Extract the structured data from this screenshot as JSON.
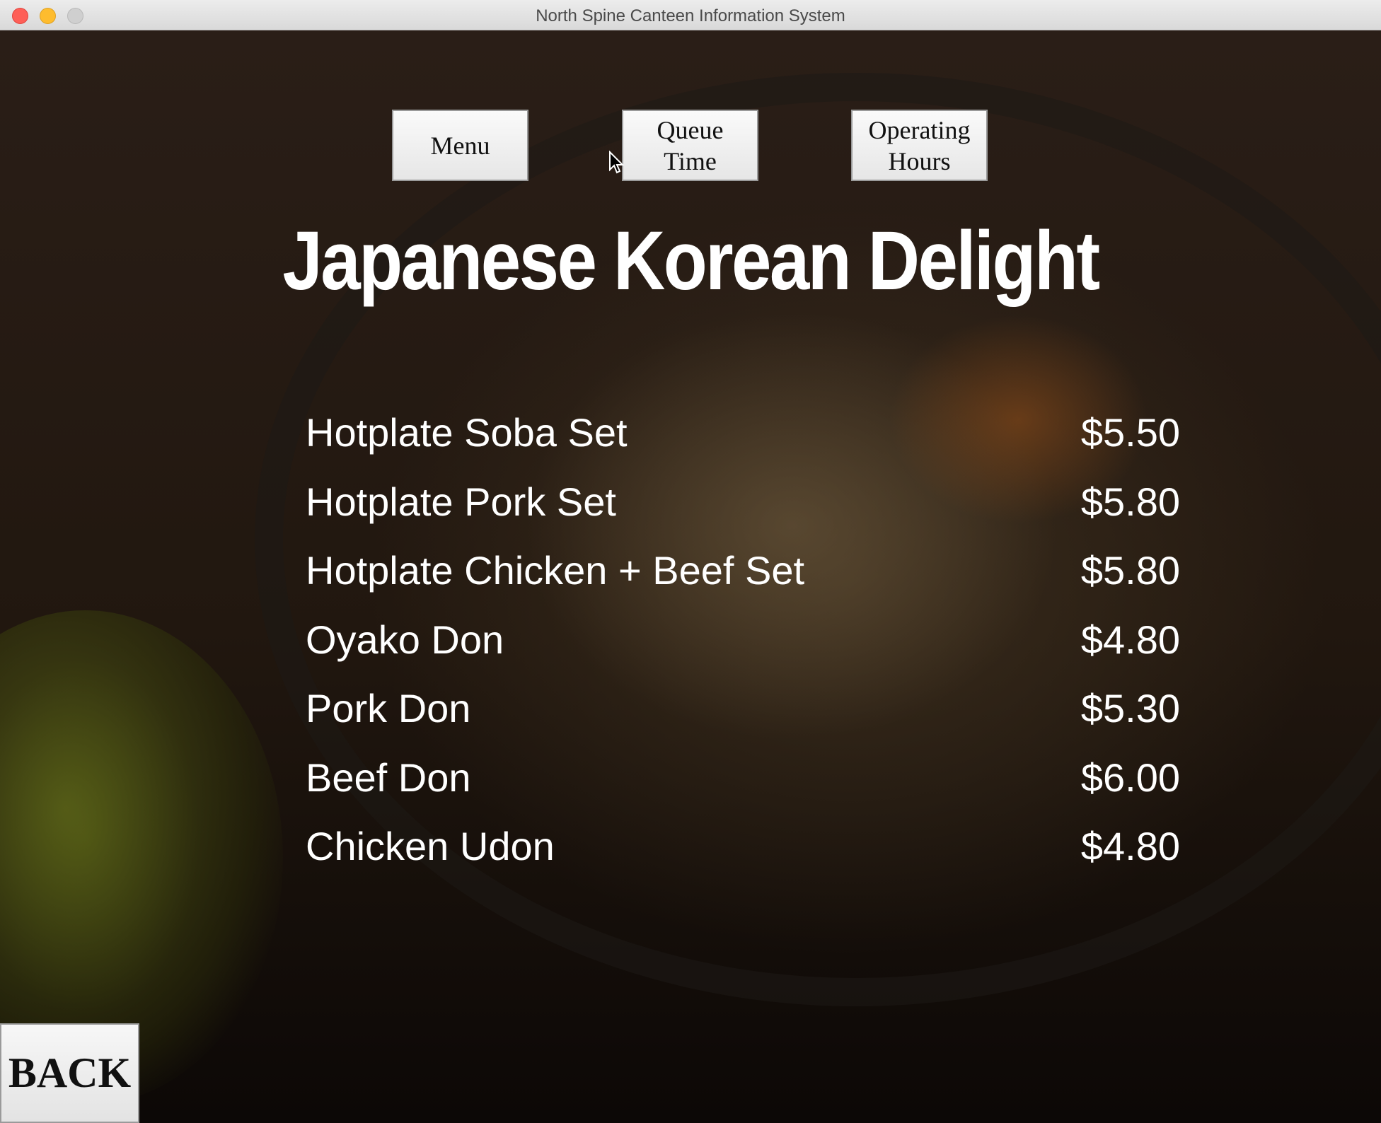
{
  "window": {
    "title": "North Spine Canteen Information System"
  },
  "nav": {
    "menu_label": "Menu",
    "queue_label_line1": "Queue",
    "queue_label_line2": "Time",
    "hours_label_line1": "Operating",
    "hours_label_line2": "Hours"
  },
  "stall": {
    "name": "Japanese Korean Delight"
  },
  "menu_items": [
    {
      "name": "Hotplate Soba Set",
      "price": "$5.50"
    },
    {
      "name": "Hotplate Pork Set",
      "price": "$5.80"
    },
    {
      "name": "Hotplate Chicken + Beef Set",
      "price": "$5.80"
    },
    {
      "name": "Oyako Don",
      "price": "$4.80"
    },
    {
      "name": "Pork Don",
      "price": "$5.30"
    },
    {
      "name": "Beef Don",
      "price": "$6.00"
    },
    {
      "name": "Chicken Udon",
      "price": "$4.80"
    }
  ],
  "footer": {
    "back_label": "BACK"
  },
  "colors": {
    "menu_text": "#ffffff",
    "button_face": "#eeeeee",
    "close": "#fe5f57",
    "minimize": "#febc2e"
  },
  "icons": {
    "background": "rice-bowl-photo",
    "pointer": "mouse-pointer-icon"
  }
}
